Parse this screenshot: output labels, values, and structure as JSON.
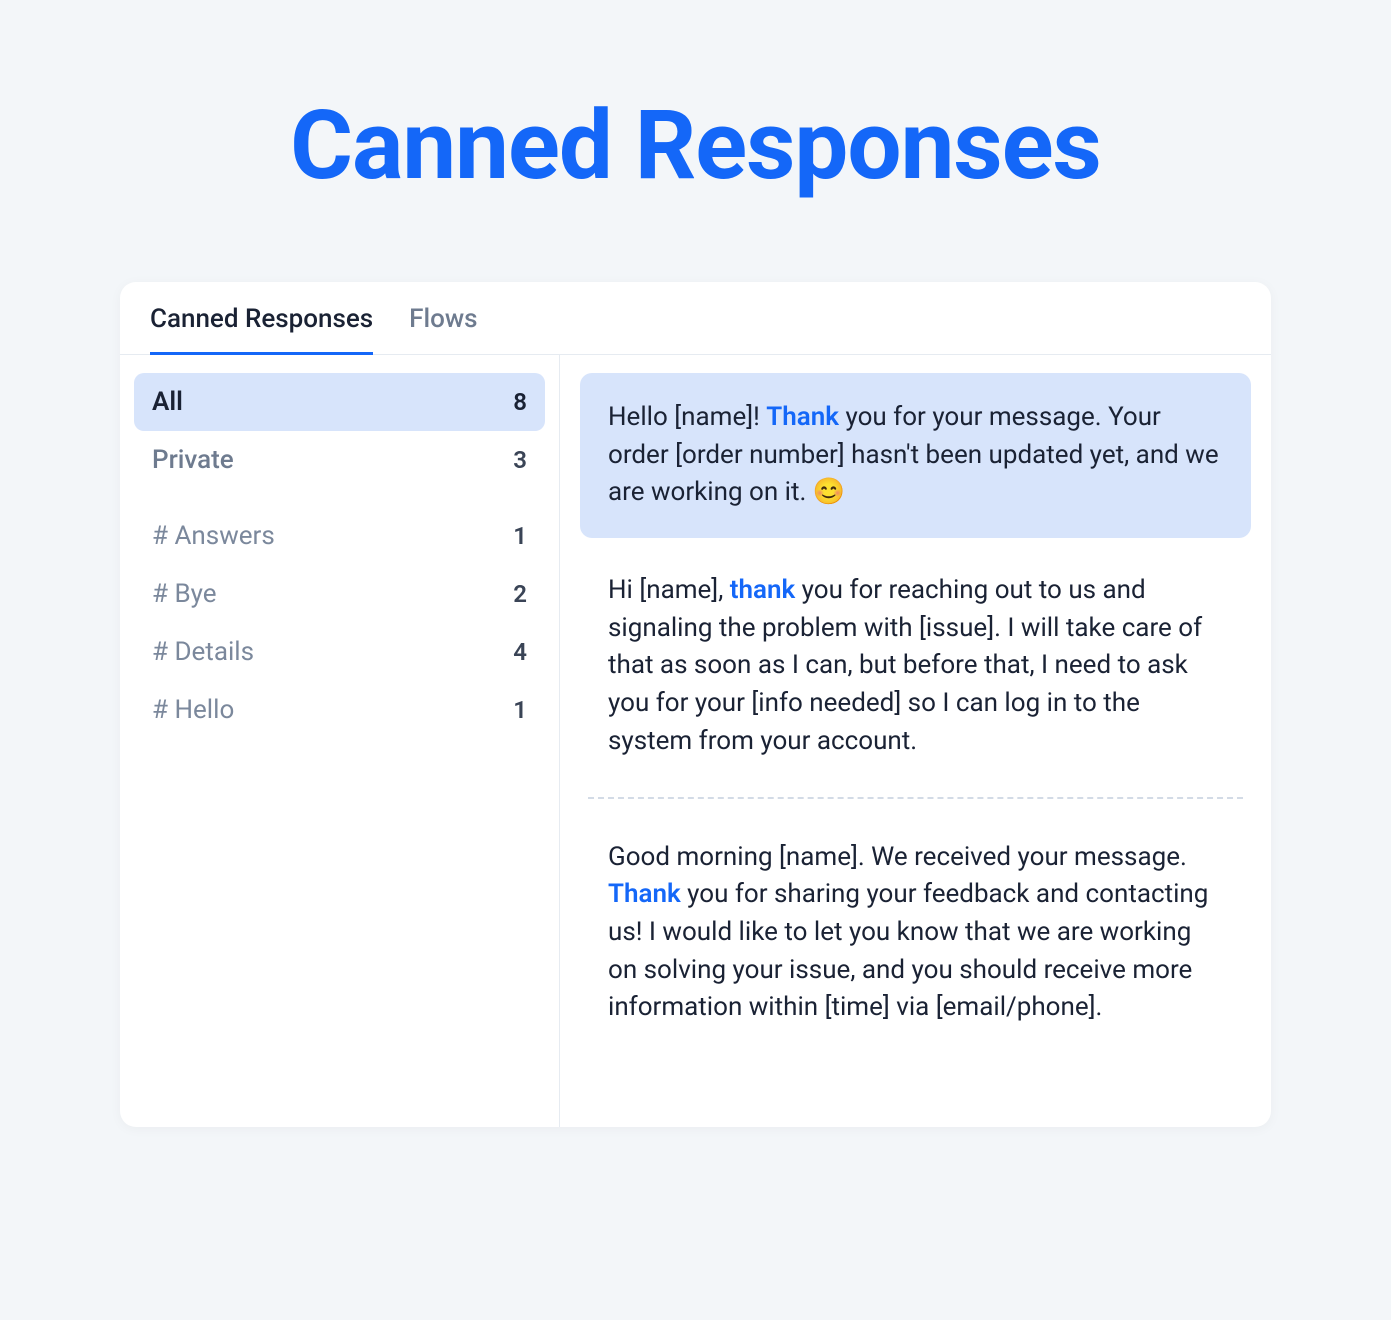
{
  "title": "Canned Responses",
  "tabs": [
    {
      "label": "Canned Responses",
      "active": true
    },
    {
      "label": "Flows",
      "active": false
    }
  ],
  "sidebar": {
    "groups": [
      [
        {
          "label": "All",
          "count": "8",
          "active": true,
          "tag": false
        },
        {
          "label": "Private",
          "count": "3",
          "active": false,
          "tag": false
        }
      ],
      [
        {
          "label": "# Answers",
          "count": "1",
          "active": false,
          "tag": true
        },
        {
          "label": "# Bye",
          "count": "2",
          "active": false,
          "tag": true
        },
        {
          "label": "# Details",
          "count": "4",
          "active": false,
          "tag": true
        },
        {
          "label": "# Hello",
          "count": "1",
          "active": false,
          "tag": true
        }
      ]
    ]
  },
  "responses": [
    {
      "selected": true,
      "parts": [
        {
          "t": "Hello [name]! "
        },
        {
          "t": "Thank",
          "hl": true
        },
        {
          "t": " you for your message. Your order [order number] hasn't been updated yet, and we are working on it. 😊"
        }
      ]
    },
    {
      "selected": false,
      "parts": [
        {
          "t": "Hi [name], "
        },
        {
          "t": "thank",
          "hl": true
        },
        {
          "t": " you for reaching out to us and signaling the problem with [issue]. I will take care of that as soon as I can, but before that, I need to ask you for your [info needed] so I can log in to the system from your account."
        }
      ]
    },
    {
      "selected": false,
      "divider_before": true,
      "parts": [
        {
          "t": "Good morning [name]. We received your message. "
        },
        {
          "t": "Thank",
          "hl": true
        },
        {
          "t": " you for sharing your feedback and contacting us! I would like to let you know that we are working on solving your issue, and you should receive more information within [time] via [email/phone]."
        }
      ]
    }
  ]
}
